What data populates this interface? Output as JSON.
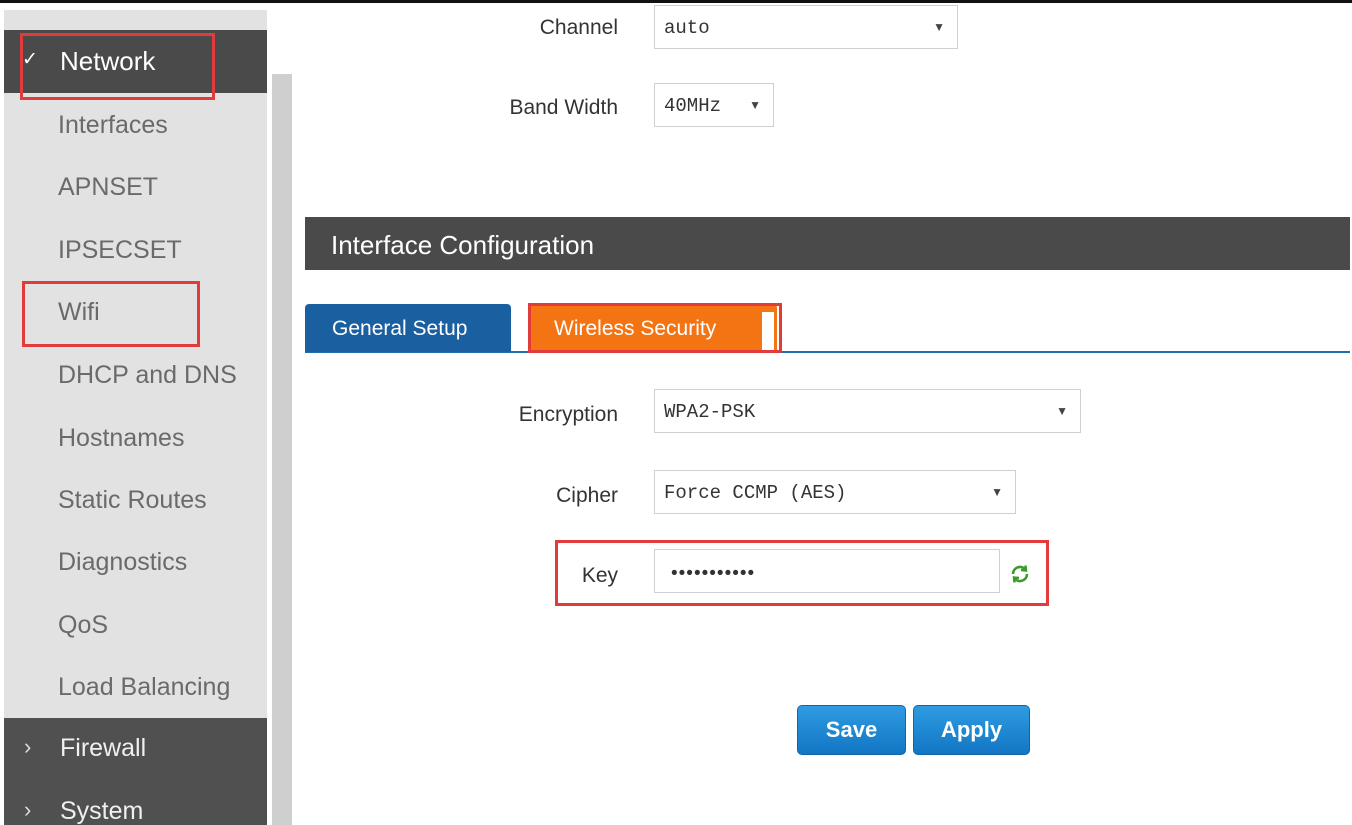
{
  "sidebar": {
    "header_label": "Network",
    "items": [
      {
        "label": "Interfaces"
      },
      {
        "label": "APNSET"
      },
      {
        "label": "IPSECSET"
      },
      {
        "label": "Wifi"
      },
      {
        "label": "DHCP and DNS"
      },
      {
        "label": "Hostnames"
      },
      {
        "label": "Static Routes"
      },
      {
        "label": "Diagnostics"
      },
      {
        "label": "QoS"
      },
      {
        "label": "Load Balancing"
      }
    ],
    "groups": [
      {
        "label": "Firewall"
      },
      {
        "label": "System"
      }
    ]
  },
  "wireless": {
    "channel_label": "Channel",
    "channel_value": "auto",
    "bandwidth_label": "Band Width",
    "bandwidth_value": "40MHz"
  },
  "section": {
    "title": "Interface Configuration"
  },
  "tabs": [
    {
      "label": "General Setup",
      "active": false
    },
    {
      "label": "Wireless Security",
      "active": true
    }
  ],
  "security": {
    "encryption_label": "Encryption",
    "encryption_value": "WPA2-PSK",
    "cipher_label": "Cipher",
    "cipher_value": "Force CCMP (AES)",
    "key_label": "Key",
    "key_value": "•••••••••••"
  },
  "buttons": {
    "save": "Save",
    "apply": "Apply"
  },
  "colors": {
    "header_bg": "#4a4a4a",
    "tab_active": "#f47414",
    "tab_inactive": "#1a5fa0",
    "button": "#1a82d0",
    "highlight": "#e23b3b"
  }
}
